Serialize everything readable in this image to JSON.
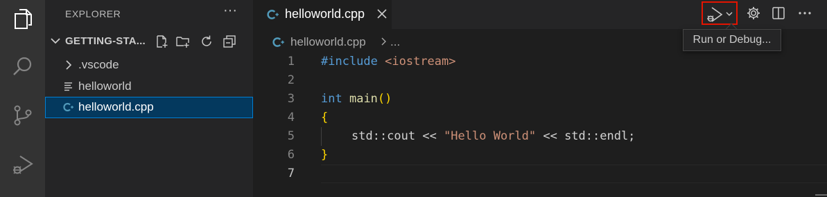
{
  "activity_bar": {
    "items": [
      {
        "name": "explorer-icon"
      },
      {
        "name": "search-icon"
      },
      {
        "name": "source-control-icon"
      },
      {
        "name": "run-debug-icon"
      }
    ]
  },
  "sidebar": {
    "title": "EXPLORER",
    "more": "···",
    "folder": {
      "name": "GETTING-STA..."
    },
    "files": [
      {
        "label": ".vscode",
        "icon": "chevron-right-icon"
      },
      {
        "label": "helloworld",
        "icon": "file-lines-icon"
      },
      {
        "label": "helloworld.cpp",
        "icon": "cpp-icon",
        "selected": true
      }
    ]
  },
  "editor": {
    "tab": {
      "label": "helloworld.cpp"
    },
    "breadcrumb": {
      "file": "helloworld.cpp",
      "more": "..."
    },
    "tooltip": "Run or Debug...",
    "lines": [
      {
        "number": "1"
      },
      {
        "number": "2"
      },
      {
        "number": "3"
      },
      {
        "number": "4"
      },
      {
        "number": "5"
      },
      {
        "number": "6"
      },
      {
        "number": "7"
      }
    ],
    "code": {
      "l1_directive": "#include",
      "l1_header": "<iostream>",
      "l3_type": "int",
      "l3_fn": "main",
      "l3_parens": "()",
      "l4_brace": "{",
      "l5_pre": "std::cout << ",
      "l5_string": "\"Hello World\"",
      "l5_post": " << std::endl;",
      "l6_brace": "}"
    }
  },
  "colors": {
    "accent": "#007fd4",
    "selection": "#04395e",
    "highlight_border": "#e51400",
    "cpp_icon": "#519aba"
  }
}
